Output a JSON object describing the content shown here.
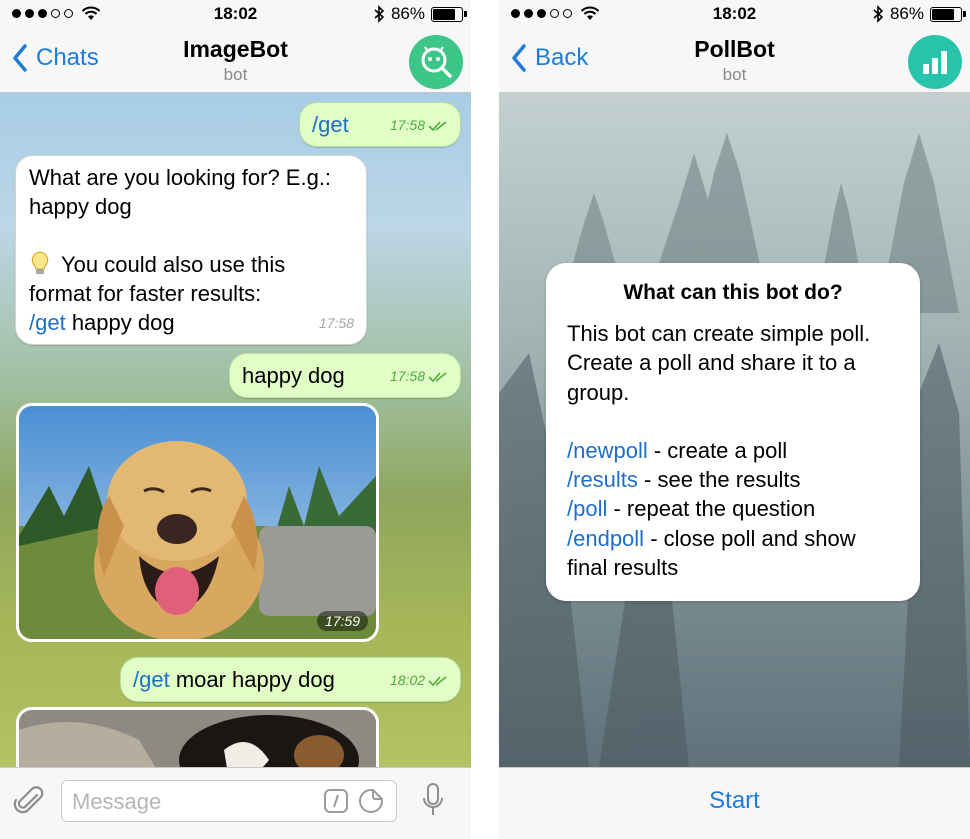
{
  "left_phone": {
    "status": {
      "time": "18:02",
      "battery": "86%",
      "battery_level": 0.86
    },
    "nav": {
      "back_label": "Chats",
      "title": "ImageBot",
      "subtitle": "bot",
      "avatar_color": "#3cc688"
    },
    "messages": [
      {
        "dir": "out",
        "cmd": "/get",
        "time": "17:58"
      },
      {
        "dir": "in",
        "line1": "What are you looking for? E.g.:",
        "line2": "happy dog",
        "tip_line1": "You could also use this",
        "tip_line2": "format for faster results:",
        "cmd": "/get",
        "rest": " happy dog",
        "time": "17:58"
      },
      {
        "dir": "out",
        "text": "happy dog",
        "time": "17:58"
      },
      {
        "dir": "photo",
        "time": "17:59"
      },
      {
        "dir": "out",
        "cmd": "/get",
        "rest": " moar happy dog",
        "time": "18:02"
      }
    ],
    "input": {
      "placeholder": "Message"
    }
  },
  "right_phone": {
    "status": {
      "time": "18:02",
      "battery": "86%",
      "battery_level": 0.86
    },
    "nav": {
      "back_label": "Back",
      "title": "PollBot",
      "subtitle": "bot",
      "avatar_color": "#28c3ab"
    },
    "card": {
      "title": "What can this bot do?",
      "intro": [
        "This bot can create simple poll.",
        "Create a poll and share it to a",
        "group."
      ],
      "commands": [
        {
          "cmd": "/newpoll",
          "desc": " - create a poll"
        },
        {
          "cmd": "/results",
          "desc": " - see the results"
        },
        {
          "cmd": "/poll",
          "desc": " - repeat the question"
        },
        {
          "cmd": "/endpoll",
          "desc": " - close poll and show"
        }
      ],
      "tail": "final results"
    },
    "start_label": "Start"
  },
  "colors": {
    "accent_blue": "#1e7cd8",
    "link_blue": "#1e6fc8",
    "outgoing_bubble": "#e1fec6",
    "read_check_green": "#4daa3c"
  },
  "icons": [
    "back-chevron-icon",
    "wifi-icon",
    "bluetooth-icon",
    "battery-icon",
    "robot-search-icon",
    "bar-chart-icon",
    "lightbulb-icon",
    "double-check-icon",
    "paperclip-icon",
    "slash-command-icon",
    "sticker-icon",
    "microphone-icon"
  ]
}
